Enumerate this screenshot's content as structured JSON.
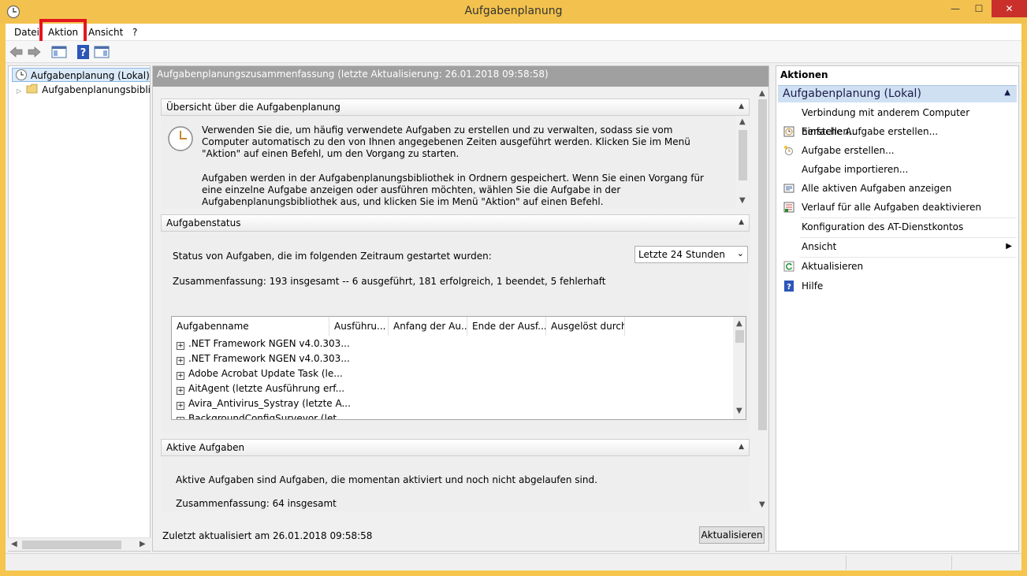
{
  "window": {
    "title": "Aufgabenplanung",
    "minimize": "—",
    "maximize": "☐",
    "close": "✕"
  },
  "menu": {
    "items": [
      "Datei",
      "Aktion",
      "Ansicht",
      "?"
    ]
  },
  "tree": {
    "root": "Aufgabenplanung (Lokal)",
    "child": "Aufgabenplanungsbibliot"
  },
  "middle": {
    "header": "Aufgabenplanungszusammenfassung (letzte Aktualisierung: 26.01.2018 09:58:58)",
    "overview": {
      "title": "Übersicht über die Aufgabenplanung",
      "para1": "Verwenden Sie die, um häufig verwendete Aufgaben zu erstellen und zu verwalten, sodass sie vom Computer automatisch zu den von Ihnen angegebenen Zeiten ausgeführt werden. Klicken Sie im Menü \"Aktion\" auf einen Befehl, um den Vorgang zu starten.",
      "para2": "Aufgaben werden in der Aufgabenplanungsbibliothek in Ordnern gespeichert. Wenn Sie einen Vorgang für eine einzelne Aufgabe anzeigen oder ausführen möchten, wählen Sie die Aufgabe in der Aufgabenplanungsbibliothek aus, und klicken Sie im Menü \"Aktion\" auf einen Befehl."
    },
    "status": {
      "title": "Aufgabenstatus",
      "prompt": "Status von Aufgaben, die im folgenden Zeitraum gestartet wurden:",
      "range": "Letzte 24 Stunden",
      "summary": "Zusammenfassung: 193 insgesamt -- 6 ausgeführt, 181 erfolgreich, 1 beendet, 5 fehlerhaft",
      "columns": [
        "Aufgabenname",
        "Ausführu...",
        "Anfang der Au...",
        "Ende der Ausf...",
        "Ausgelöst durch"
      ],
      "rows": [
        ".NET Framework NGEN v4.0.303...",
        ".NET Framework NGEN v4.0.303...",
        "Adobe Acrobat Update Task (le...",
        "AitAgent (letzte Ausführung erf...",
        "Avira_Antivirus_Systray (letzte A...",
        "BackgroundConfigSurveyor (let..."
      ]
    },
    "active": {
      "title": "Aktive Aufgaben",
      "desc": "Aktive Aufgaben sind Aufgaben, die momentan aktiviert und noch nicht abgelaufen sind.",
      "summary": "Zusammenfassung: 64 insgesamt"
    },
    "footer": {
      "updated": "Zuletzt aktualisiert am 26.01.2018 09:58:58",
      "refresh": "Aktualisieren"
    }
  },
  "actions": {
    "title": "Aktionen",
    "group": "Aufgabenplanung (Lokal)",
    "items": [
      "Verbindung mit anderem Computer herstellen...",
      "Einfache Aufgabe erstellen...",
      "Aufgabe erstellen...",
      "Aufgabe importieren...",
      "Alle aktiven Aufgaben anzeigen",
      "Verlauf für alle Aufgaben deaktivieren",
      "Konfiguration des AT-Dienstkontos",
      "Ansicht",
      "Aktualisieren",
      "Hilfe"
    ]
  },
  "colors": {
    "title_bar": "#f3c24e",
    "highlight": "#e3161e",
    "selection": "#dbeaf9",
    "action_group": "#cfe0f3"
  }
}
